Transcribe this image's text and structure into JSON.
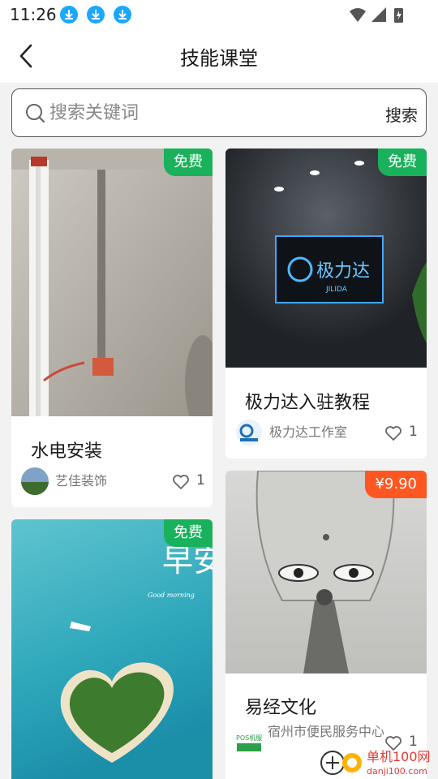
{
  "status": {
    "time": "11:26"
  },
  "header": {
    "title": "技能课堂"
  },
  "search": {
    "placeholder": "搜索关键词",
    "button_label": "搜索"
  },
  "courses": [
    {
      "title": "水电安装",
      "badge": "免费",
      "author": "艺佳装饰",
      "likes": "1"
    },
    {
      "title": "极力达入驻教程",
      "badge": "免费",
      "author": "极力达工作室",
      "likes": "1",
      "sign_text": "极力达",
      "sign_sub": "JILIDA"
    },
    {
      "title": "",
      "badge": "免费",
      "overlay_text": "早安",
      "overlay_sub": "Good morning"
    },
    {
      "title": "易经文化",
      "badge": "¥9.90",
      "author": "宿州市便民服务中心",
      "likes": "1",
      "avatar_text": "POS机服务商"
    }
  ],
  "watermark": {
    "text": "单机100网",
    "sub": "danji100.com"
  },
  "colors": {
    "badge_free": "#19b15b",
    "badge_price": "#ff5722",
    "download_icon": "#18a8ff"
  }
}
